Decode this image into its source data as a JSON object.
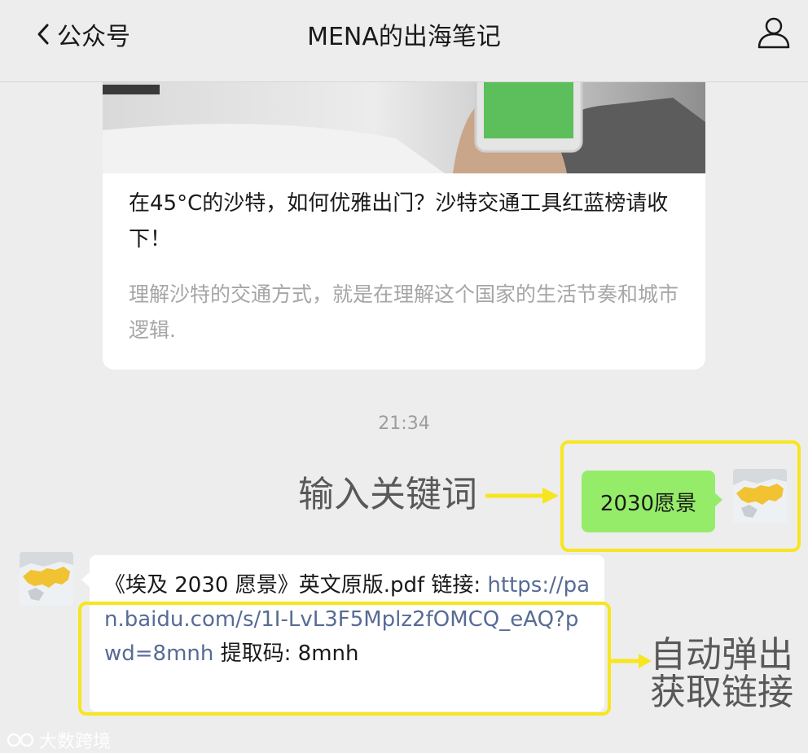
{
  "header": {
    "back_label": "公众号",
    "title": "MENA的出海笔记"
  },
  "article": {
    "title": "在45°C的沙特，如何优雅出门？沙特交通工具红蓝榜请收下！",
    "description": "理解沙特的交通方式，就是在理解这个国家的生活节奏和城市逻辑."
  },
  "timestamp": "21:34",
  "outgoing_message": "2030愿景",
  "incoming_message": {
    "prefix": "《埃及 2030 愿景》英文原版.pdf 链接: ",
    "link": "https://pan.baidu.com/s/1I-LvL3F5Mplz2fOMCQ_eAQ?pwd=8mnh",
    "suffix": " 提取码: 8mnh"
  },
  "annotations": {
    "input_keyword": "输入关键词",
    "auto_popup_line1": "自动弹出",
    "auto_popup_line2": "获取链接"
  },
  "watermark": "大数跨境",
  "colors": {
    "highlight": "#f7e51f",
    "outgoing_bubble": "#95ec69",
    "link": "#576b95",
    "background": "#ededed"
  },
  "icons": {
    "back": "chevron-left-icon",
    "profile": "person-icon",
    "avatar": "mena-map-avatar"
  }
}
